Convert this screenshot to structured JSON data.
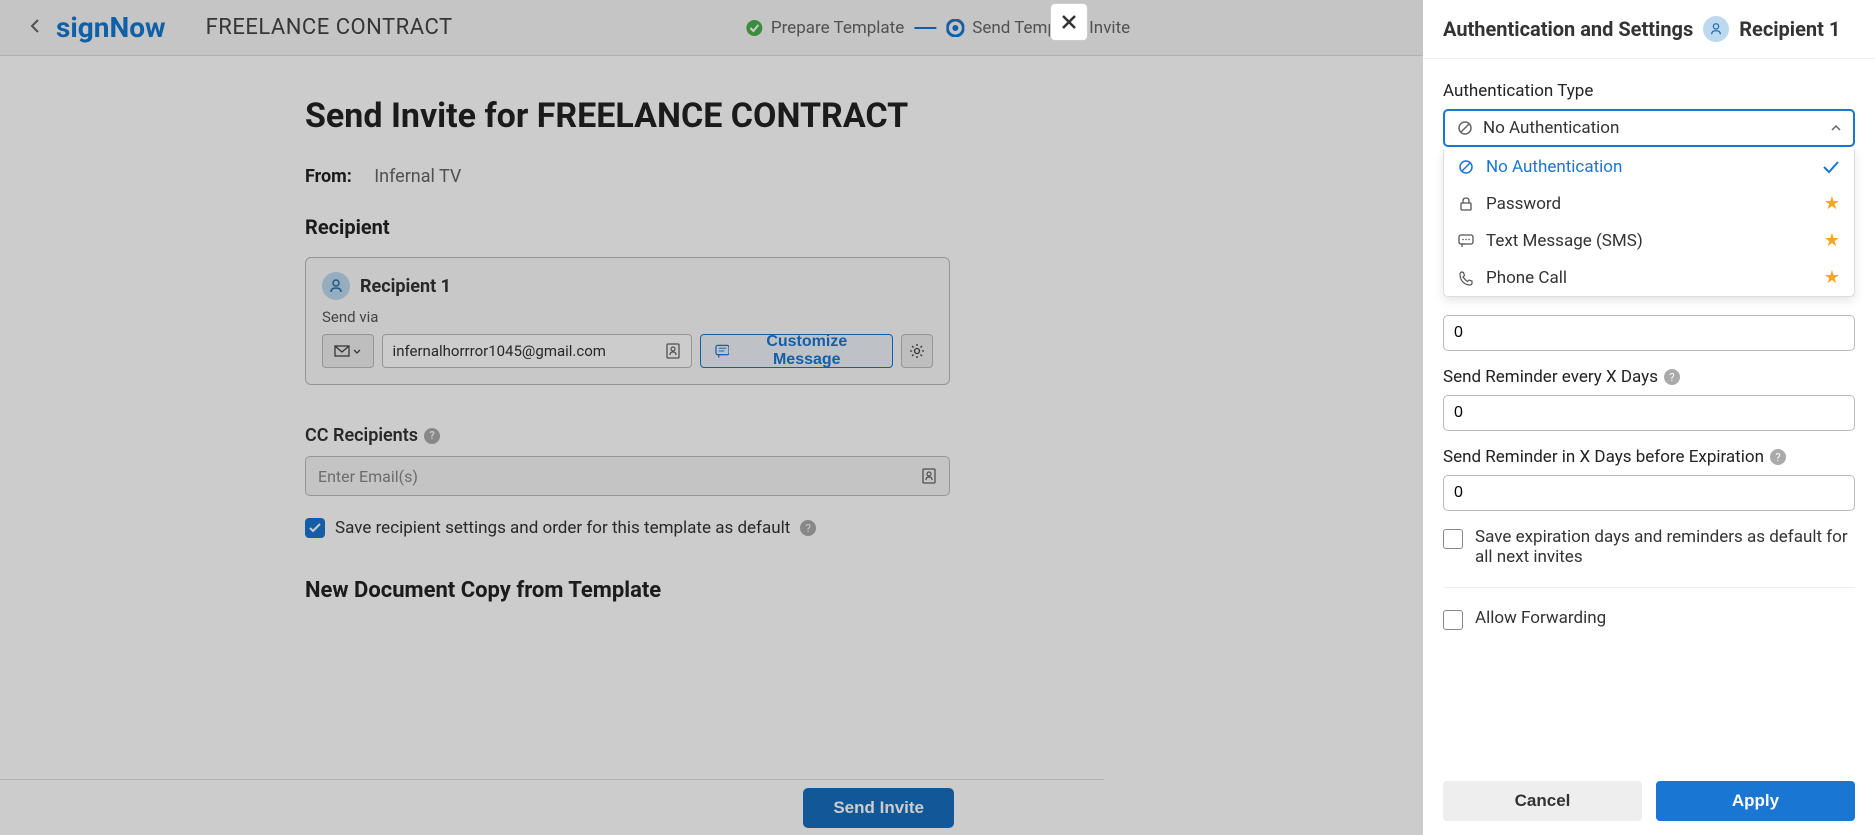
{
  "logo": "signNow",
  "document_title": "FREELANCE CONTRACT",
  "steps": {
    "prepare": "Prepare Template",
    "send": "Send Template Invite"
  },
  "page_title": "Send Invite for FREELANCE CONTRACT",
  "from": {
    "label": "From:",
    "value": "Infernal TV"
  },
  "recipient_section": "Recipient",
  "recipient": {
    "name": "Recipient 1",
    "send_via": "Send via",
    "email": "infernalhorrror1045@gmail.com",
    "customize": "Customize Message"
  },
  "cc": {
    "label": "CC Recipients",
    "placeholder": "Enter Email(s)"
  },
  "save_default": "Save recipient settings and order for this template as default",
  "newdoc": "New Document Copy from Template",
  "send_invite": "Send Invite",
  "side": {
    "title": "Authentication and Settings",
    "recipient": "Recipient 1",
    "auth_type_label": "Authentication Type",
    "auth_selected": "No Authentication",
    "options": {
      "none": "No Authentication",
      "password": "Password",
      "sms": "Text Message (SMS)",
      "phone": "Phone Call"
    },
    "reminder_every": "Send Reminder every X Days",
    "reminder_before": "Send Reminder in X Days before Expiration",
    "val_hidden": "0",
    "val_every": "0",
    "val_before": "0",
    "save_defaults": "Save expiration days and reminders as default for all next invites",
    "allow_forward": "Allow Forwarding",
    "cancel": "Cancel",
    "apply": "Apply"
  }
}
